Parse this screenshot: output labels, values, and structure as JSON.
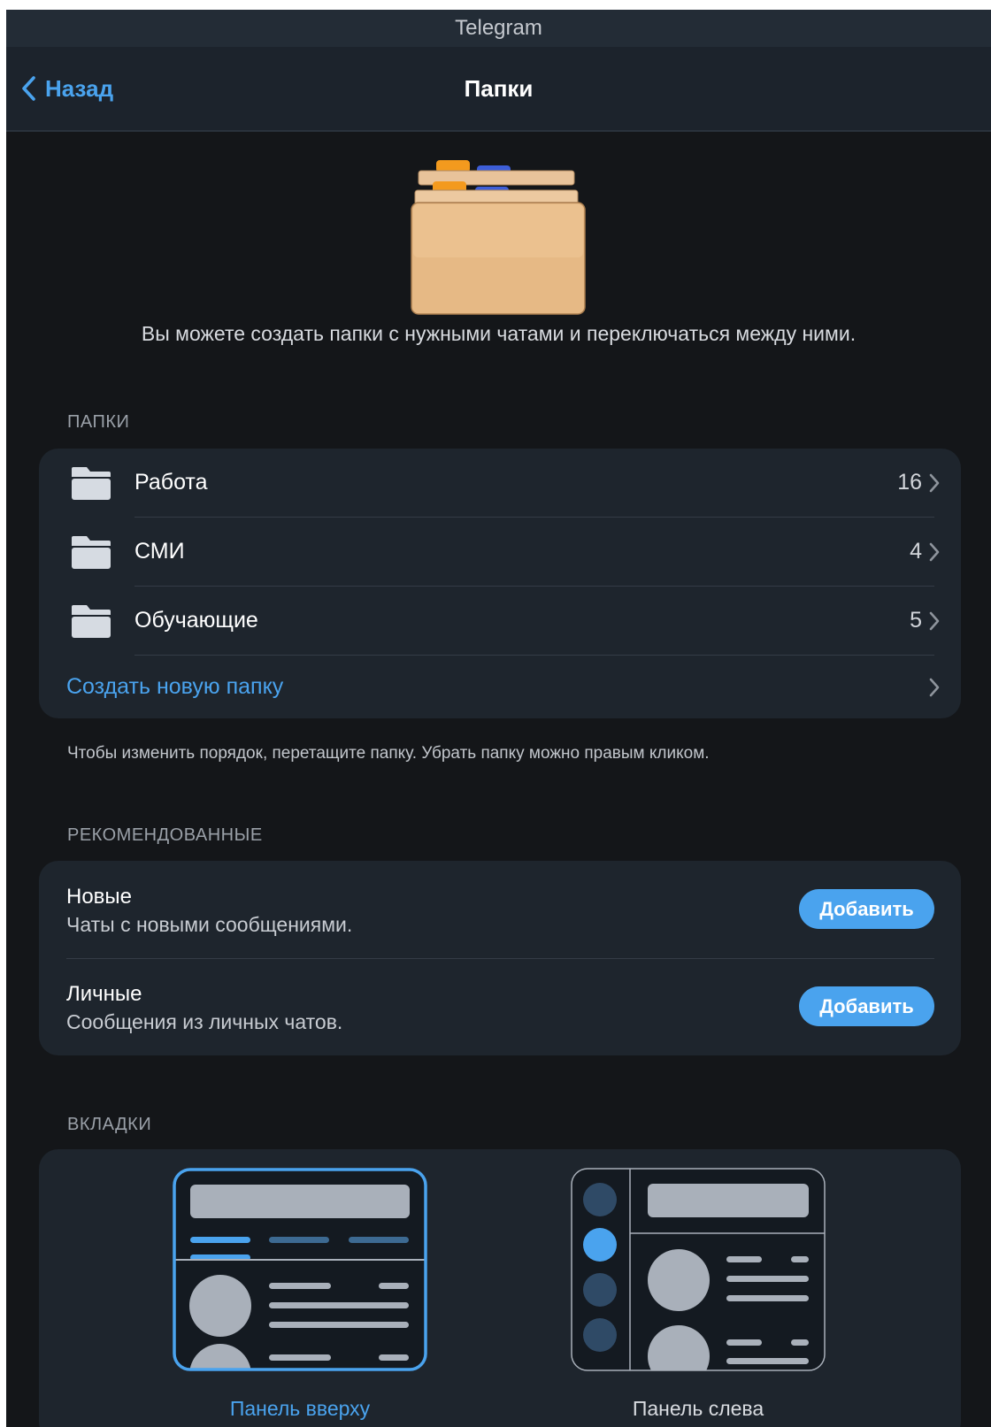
{
  "window": {
    "title": "Telegram"
  },
  "navbar": {
    "back_label": "Назад",
    "title": "Папки"
  },
  "intro": "Вы можете создать папки с нужными чатами и переключаться между ними.",
  "folders": {
    "header": "ПАПКИ",
    "items": [
      {
        "label": "Работа",
        "count": "16"
      },
      {
        "label": "СМИ",
        "count": "4"
      },
      {
        "label": "Обучающие",
        "count": "5"
      }
    ],
    "create_label": "Создать новую папку",
    "hint": "Чтобы изменить порядок, перетащите папку. Убрать папку можно правым кликом."
  },
  "recommended": {
    "header": "РЕКОМЕНДОВАННЫЕ",
    "items": [
      {
        "title": "Новые",
        "subtitle": "Чаты с новыми сообщениями.",
        "button": "Добавить"
      },
      {
        "title": "Личные",
        "subtitle": "Сообщения из личных чатов.",
        "button": "Добавить"
      }
    ]
  },
  "tabs": {
    "header": "ВКЛАДКИ",
    "options": [
      {
        "label": "Панель вверху",
        "selected": true
      },
      {
        "label": "Панель слева",
        "selected": false
      }
    ]
  },
  "colors": {
    "accent": "#4aa3ee",
    "background": "#141619",
    "card": "#1e252d",
    "titlebar": "#232c36"
  }
}
